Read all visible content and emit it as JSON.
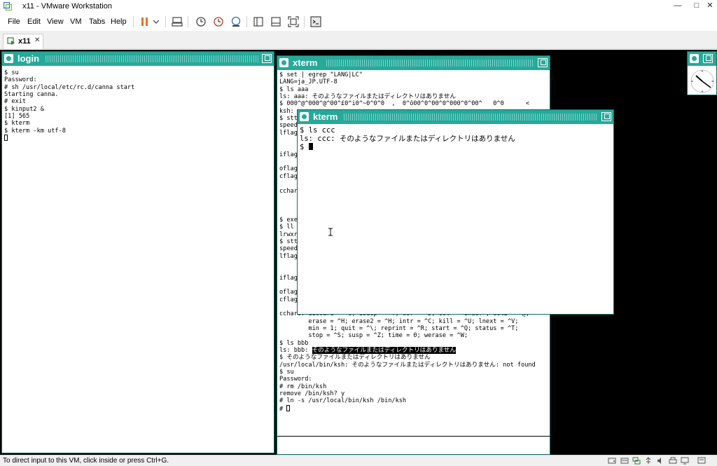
{
  "host": {
    "title": "x11 - VMware Workstation",
    "window_controls": [
      "minimize",
      "maximize",
      "close"
    ],
    "menu": [
      "File",
      "Edit",
      "View",
      "VM",
      "Tabs",
      "Help"
    ],
    "tab_label": "x11",
    "status_text": "To direct input to this VM, click inside or press Ctrl+G."
  },
  "windows": {
    "login": {
      "title": "login",
      "lines": [
        "$ su",
        "Password:",
        "# sh /usr/local/etc/rc.d/canna start",
        "Starting canna.",
        "# exit",
        "$ kinput2 &",
        "[1] 565",
        "$ kterm",
        "$ kterm -km utf-8"
      ]
    },
    "xterm": {
      "title": "xterm",
      "lines": [
        "$ set | egrep \"LANG|LC\"",
        "LANG=ja_JP.UTF-8",
        "$ ls aaa",
        "ls: aaa: そのようなファイルまたはディレクトリはありません",
        "$ 000^@^000^@^00^£0^i0^~0^0^0  ,  0^ô00^0^00^0^000^0^00^   0^0      <",
        "ksh:",
        "$ stt",
        "speed",
        "lflag",
        "",
        "",
        "iflag",
        "",
        "oflag",
        "cflag",
        "",
        "cchar",
        "",
        "",
        "",
        "$ exe",
        "$ ll",
        "lrwxr",
        "$ stt",
        "speed",
        "lflag",
        "",
        "",
        "iflag",
        "",
        "oflag",
        "cflag",
        "",
        "cchars: discard = ^O; dsusp = ^Y; eof = ^D; eol = <undef>; eol2 = ^@;",
        "        erase = ^H; erase2 = ^H; intr = ^C; kill = ^U; lnext = ^V;",
        "        min = 1; quit = ^\\; reprint = ^R; start = ^Q; status = ^T;",
        "        stop = ^S; susp = ^Z; time = 0; werase = ^W;",
        "$ ls bbb"
      ],
      "sel_prefix": "ls: bbb: ",
      "sel_text": "そのようなファイルまたはディレクトリはありません",
      "lines_after": [
        "$ そのようなファイルまたはディレクトリはありません",
        "/usr/local/bin/ksh: そのようなファイルまたはディレクトリはありません: not found",
        "$ su",
        "Password:",
        "# rm /bin/ksh",
        "remove /bin/ksh? y",
        "# ln -s /usr/local/bin/ksh /bin/ksh"
      ],
      "prompt_last": "# "
    },
    "kterm": {
      "title": "kterm",
      "lines": [
        "$ ls ccc",
        "ls: ccc: そのようなファイルまたはディレクトリはありません"
      ],
      "prompt": "$ "
    }
  },
  "colors": {
    "titlebar": "#27a99a",
    "desktop": "#000000",
    "pause_icon": "#e8732e"
  },
  "icons": {
    "text_cursor": "ibeam-cursor-icon",
    "clock": "xclock-icon"
  }
}
